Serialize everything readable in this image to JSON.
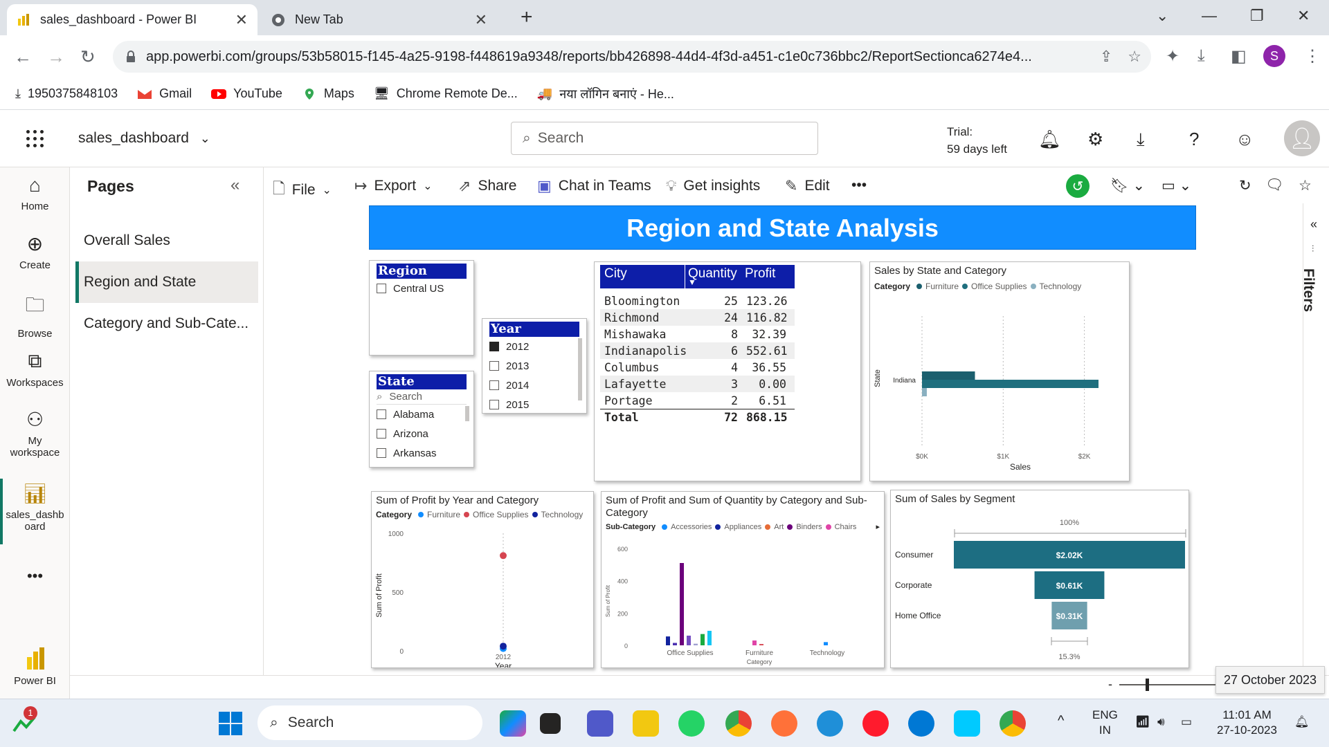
{
  "browser": {
    "tabs": [
      {
        "title": "sales_dashboard - Power BI",
        "close": "✕"
      },
      {
        "title": "New Tab",
        "close": "✕"
      }
    ],
    "new_tab": "+",
    "url": "app.powerbi.com/groups/53b58015-f145-4a25-9198-f448619a9348/reports/bb426898-44d4-4f3d-a451-c1e0c736bbc2/ReportSectionca6274e4...",
    "profile_initial": "S",
    "bookmarks": [
      "1950375848103",
      "Gmail",
      "YouTube",
      "Maps",
      "Chrome Remote De...",
      "नया लॉगिन बनाएं - He..."
    ]
  },
  "pbi": {
    "report_name": "sales_dashboard",
    "search_placeholder": "Search",
    "trial_line1": "Trial:",
    "trial_line2": "59 days left"
  },
  "rail": {
    "home": "Home",
    "create": "Create",
    "browse": "Browse",
    "workspaces": "Workspaces",
    "my_ws_1": "My",
    "my_ws_2": "workspace",
    "report_1": "sales_dashb",
    "report_2": "oard",
    "more": "•••",
    "powerbi": "Power BI"
  },
  "pages": {
    "title": "Pages",
    "items": [
      "Overall Sales",
      "Region and State",
      "Category and Sub-Cate..."
    ]
  },
  "actions": {
    "file": "File",
    "export": "Export",
    "share": "Share",
    "chat": "Chat in Teams",
    "insights": "Get insights",
    "edit": "Edit",
    "more": "•••"
  },
  "report": {
    "banner": "Region and State Analysis",
    "region_slicer": {
      "header": "Region",
      "options": [
        "Central US"
      ]
    },
    "year_slicer": {
      "header": "Year",
      "options": [
        "2012",
        "2013",
        "2014",
        "2015"
      ],
      "checked": "2012"
    },
    "state_slicer": {
      "header": "State",
      "search": "Search",
      "options": [
        "Alabama",
        "Arizona",
        "Arkansas"
      ]
    },
    "city_table": {
      "headers": [
        "City",
        "Quantity",
        "Profit"
      ],
      "rows": [
        [
          "Bloomington",
          "25",
          "123.26"
        ],
        [
          "Richmond",
          "24",
          "116.82"
        ],
        [
          "Mishawaka",
          "8",
          "32.39"
        ],
        [
          "Indianapolis",
          "6",
          "552.61"
        ],
        [
          "Columbus",
          "4",
          "36.55"
        ],
        [
          "Lafayette",
          "3",
          "0.00"
        ],
        [
          "Portage",
          "2",
          "6.51"
        ]
      ],
      "total": [
        "Total",
        "72",
        "868.15"
      ]
    },
    "filters_label": "Filters"
  },
  "chart_data": [
    {
      "type": "bar",
      "title": "Sales by State and Category",
      "legend_title": "Category",
      "orientation": "horizontal",
      "categories": [
        "Indiana"
      ],
      "series": [
        {
          "name": "Furniture",
          "values": [
            660
          ],
          "color": "#1b5f6e"
        },
        {
          "name": "Office Supplies",
          "values": [
            2200
          ],
          "color": "#1f6f7e"
        },
        {
          "name": "Technology",
          "values": [
            60
          ],
          "color": "#8ab0c0"
        }
      ],
      "xlabel": "Sales",
      "ylabel": "State",
      "xticks": [
        "$0K",
        "$1K",
        "$2K"
      ],
      "xlim": [
        0,
        2200
      ]
    },
    {
      "type": "scatter",
      "title": "Sum of Profit by Year and Category",
      "legend_title": "Category",
      "x": [
        "2012"
      ],
      "series": [
        {
          "name": "Furniture",
          "values": [
            20
          ],
          "color": "#118dff"
        },
        {
          "name": "Office Supplies",
          "values": [
            810
          ],
          "color": "#d64550"
        },
        {
          "name": "Technology",
          "values": [
            40
          ],
          "color": "#12239e"
        }
      ],
      "xlabel": "Year",
      "ylabel": "Sum of Profit",
      "yticks": [
        "0",
        "500",
        "1000"
      ],
      "ylim": [
        0,
        1000
      ]
    },
    {
      "type": "bar",
      "title": "Sum of Profit and Sum of Quantity by Category and Sub-Category",
      "legend_title": "Sub-Category",
      "legend_items": [
        {
          "name": "Accessories",
          "color": "#118dff"
        },
        {
          "name": "Appliances",
          "color": "#12239e"
        },
        {
          "name": "Art",
          "color": "#e66c37"
        },
        {
          "name": "Binders",
          "color": "#6b007b"
        },
        {
          "name": "Chairs",
          "color": "#e044a7"
        }
      ],
      "categories": [
        "Office Supplies",
        "Furniture",
        "Technology"
      ],
      "bars": [
        {
          "category": "Office Supplies",
          "value": 55,
          "color": "#12239e"
        },
        {
          "category": "Office Supplies",
          "value": 15,
          "color": "#4a2fb0"
        },
        {
          "category": "Office Supplies",
          "value": 510,
          "color": "#6b007b"
        },
        {
          "category": "Office Supplies",
          "value": 60,
          "color": "#744ec2"
        },
        {
          "category": "Office Supplies",
          "value": 10,
          "color": "#a0a0d0"
        },
        {
          "category": "Office Supplies",
          "value": 70,
          "color": "#1aab40"
        },
        {
          "category": "Office Supplies",
          "value": 90,
          "color": "#15c6f4"
        },
        {
          "category": "Furniture",
          "value": 30,
          "color": "#e044a7"
        },
        {
          "category": "Furniture",
          "value": 8,
          "color": "#d64550"
        },
        {
          "category": "Technology",
          "value": 20,
          "color": "#118dff"
        }
      ],
      "xlabel": "Category",
      "ylabel": "Sum of Profit",
      "yticks": [
        "0",
        "200",
        "400",
        "600"
      ],
      "ylim": [
        0,
        600
      ]
    },
    {
      "type": "bar",
      "title": "Sum of Sales by Segment",
      "orientation": "funnel",
      "categories": [
        "Consumer",
        "Corporate",
        "Home Office"
      ],
      "values": [
        2.02,
        0.61,
        0.31
      ],
      "labels": [
        "$2.02K",
        "$0.61K",
        "$0.31K"
      ],
      "top_label": "100%",
      "bottom_label": "15.3%",
      "colors": [
        "#1d6e82",
        "#1d6e82",
        "#6f9fae"
      ]
    }
  ],
  "zoom_tooltip": "27 October 2023",
  "taskbar": {
    "search": "Search",
    "lang1": "ENG",
    "lang2": "IN",
    "time": "11:01 AM",
    "date": "27-10-2023",
    "badge": "1"
  }
}
